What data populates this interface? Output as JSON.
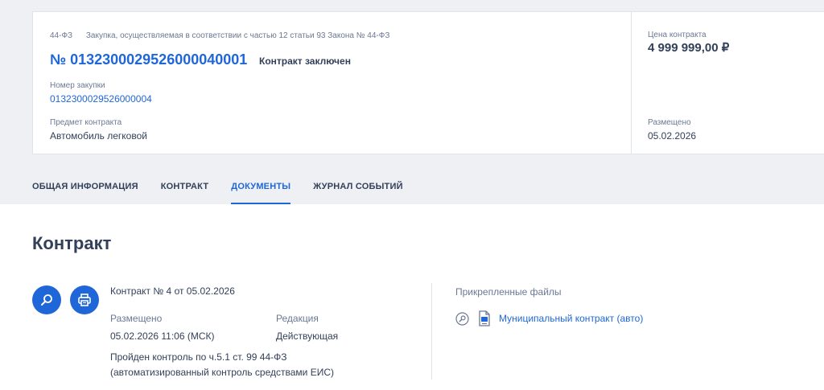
{
  "header": {
    "law": "44-ФЗ",
    "procurement_basis": "Закупка, осуществляемая в соответствии с частью 12 статьи 93 Закона № 44-ФЗ",
    "registry_number": "№ 0132300029526000040001",
    "status": "Контракт заключен",
    "purchase_number_label": "Номер закупки",
    "purchase_number": "0132300029526000004",
    "subject_label": "Предмет контракта",
    "subject": "Автомобиль легковой",
    "price_label": "Цена контракта",
    "price": "4 999 999,00 ₽",
    "placed_label": "Размещено",
    "placed_date": "05.02.2026"
  },
  "tabs": [
    {
      "label": "ОБЩАЯ ИНФОРМАЦИЯ",
      "active": false
    },
    {
      "label": "КОНТРАКТ",
      "active": false
    },
    {
      "label": "ДОКУМЕНТЫ",
      "active": true
    },
    {
      "label": "ЖУРНАЛ СОБЫТИЙ",
      "active": false
    }
  ],
  "section": {
    "title": "Контракт"
  },
  "document": {
    "title": "Контракт № 4 от 05.02.2026",
    "placed_label": "Размещено",
    "placed_value": "05.02.2026 11:06 (МСК)",
    "edition_label": "Редакция",
    "edition_value": "Действующая",
    "control_line1": "Пройден контроль по ч.5.1 ст. 99 44-ФЗ",
    "control_line2": "(автоматизированный контроль средствами ЕИС)"
  },
  "attachments": {
    "title": "Прикрепленные файлы",
    "files": [
      {
        "name": "Муниципальный контракт (авто)"
      }
    ]
  },
  "icons": {
    "view": "search-icon",
    "print": "printer-icon",
    "file_search": "search-icon",
    "file_type": "document-icon"
  },
  "colors": {
    "accent": "#1f67d8",
    "text": "#334059",
    "muted": "#6b7893",
    "header_bg": "#eef0f4"
  }
}
